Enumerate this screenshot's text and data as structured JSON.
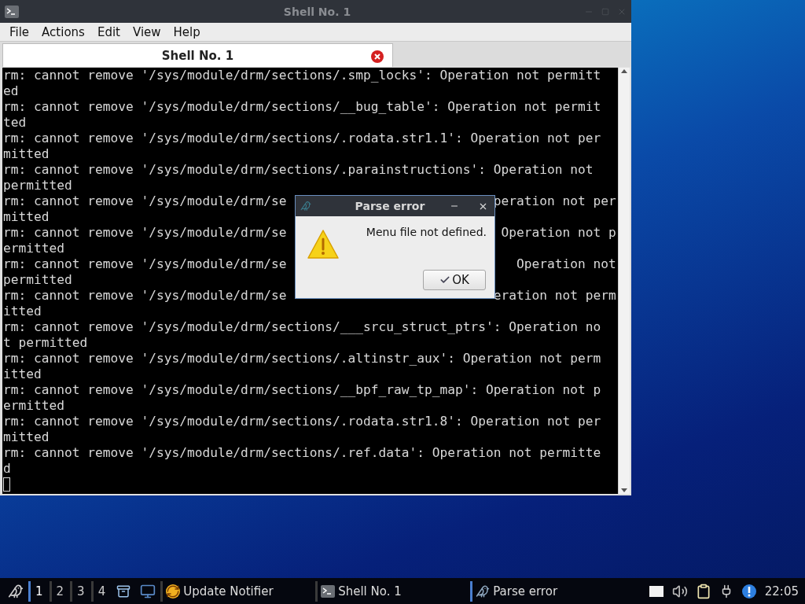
{
  "window": {
    "title": "Shell No. 1"
  },
  "menu": [
    "File",
    "Actions",
    "Edit",
    "View",
    "Help"
  ],
  "tabs": [
    {
      "label": "Shell No. 1",
      "selected": true
    }
  ],
  "terminal": {
    "lines": [
      {
        "text": "rm: cannot remove '/sys/module/drm/sections/.smp_locks': Operation not permitt"
      },
      {
        "text": "ed"
      },
      {
        "text": "rm: cannot remove '/sys/module/drm/sections/__bug_table': Operation not permit"
      },
      {
        "text": "ted"
      },
      {
        "text": "rm: cannot remove '/sys/module/drm/sections/.rodata.str1.1': Operation not per"
      },
      {
        "text": "mitted"
      },
      {
        "text": "rm: cannot remove '/sys/module/drm/sections/.parainstructions': Operation not"
      },
      {
        "text": "permitted"
      },
      {
        "left": "rm: cannot remove '/sys/module/drm/se",
        "right": "peration not per"
      },
      {
        "text": "mitted"
      },
      {
        "left": "rm: cannot remove '/sys/module/drm/se",
        "right": "Operation not p"
      },
      {
        "text": "ermitted"
      },
      {
        "left": "rm: cannot remove '/sys/module/drm/se",
        "right": "Operation not"
      },
      {
        "text": "permitted"
      },
      {
        "left": "rm: cannot remove '/sys/module/drm/se",
        "right": "eration not perm"
      },
      {
        "text": "itted"
      },
      {
        "text": "rm: cannot remove '/sys/module/drm/sections/___srcu_struct_ptrs': Operation no"
      },
      {
        "text": "t permitted"
      },
      {
        "text": "rm: cannot remove '/sys/module/drm/sections/.altinstr_aux': Operation not perm"
      },
      {
        "text": "itted"
      },
      {
        "text": "rm: cannot remove '/sys/module/drm/sections/__bpf_raw_tp_map': Operation not p"
      },
      {
        "text": "ermitted"
      },
      {
        "text": "rm: cannot remove '/sys/module/drm/sections/.rodata.str1.8': Operation not per"
      },
      {
        "text": "mitted"
      },
      {
        "text": "rm: cannot remove '/sys/module/drm/sections/.ref.data': Operation not permitte"
      },
      {
        "text": "d"
      }
    ]
  },
  "dialog": {
    "title": "Parse error",
    "message": "Menu file not defined.",
    "button": "OK"
  },
  "taskbar": {
    "workspaces": [
      {
        "label": "1",
        "selected": true
      },
      {
        "label": "2",
        "selected": false
      },
      {
        "label": "3",
        "selected": false
      },
      {
        "label": "4",
        "selected": false
      }
    ],
    "tasks": [
      {
        "label": "Update Notifier",
        "kind": "notifier",
        "selected": false
      },
      {
        "label": "Shell No. 1",
        "kind": "terminal",
        "selected": false
      },
      {
        "label": "Parse error",
        "kind": "dialog",
        "selected": true
      }
    ],
    "clock": "22:05"
  }
}
